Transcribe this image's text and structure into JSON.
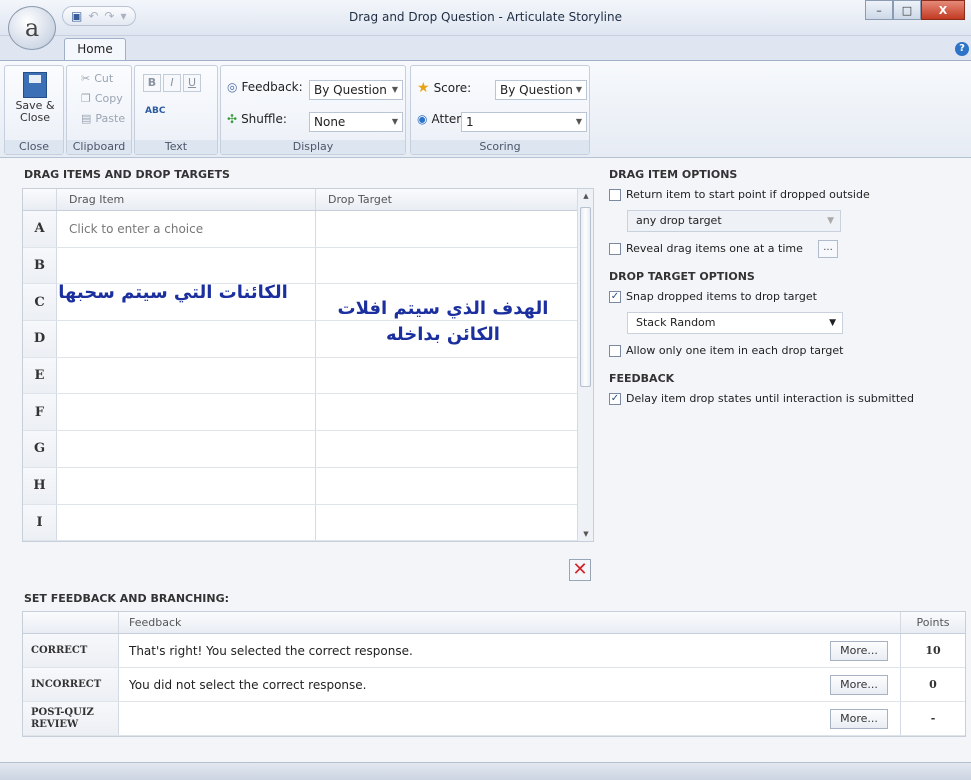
{
  "window": {
    "title": "Drag and Drop Question - Articulate Storyline",
    "logo_letter": "a",
    "minimize": "–",
    "maximize": "□",
    "close": "X"
  },
  "ribbon": {
    "tab": "Home",
    "close_group": {
      "save_label": "Save & Close",
      "group_label": "Close"
    },
    "clipboard": {
      "cut": "Cut",
      "copy": "Copy",
      "paste": "Paste",
      "group_label": "Clipboard"
    },
    "text": {
      "bold": "B",
      "italic": "I",
      "underline": "U",
      "group_label": "Text",
      "spell_icon": "ABC"
    },
    "display": {
      "feedback_label": "Feedback:",
      "feedback_value": "By Question",
      "shuffle_label": "Shuffle:",
      "shuffle_value": "None",
      "group_label": "Display"
    },
    "scoring": {
      "score_label": "Score:",
      "score_value": "By Question",
      "attempts_label": "Attempts:",
      "attempts_value": "1",
      "group_label": "Scoring"
    },
    "help": "?"
  },
  "drag_drop": {
    "title": "DRAG ITEMS AND DROP TARGETS",
    "col_drag": "Drag Item",
    "col_drop": "Drop Target",
    "rows": [
      {
        "letter": "A",
        "drag": "Click to enter a choice"
      },
      {
        "letter": "B",
        "drag": ""
      },
      {
        "letter": "C",
        "drag": ""
      },
      {
        "letter": "D",
        "drag": ""
      },
      {
        "letter": "E",
        "drag": ""
      },
      {
        "letter": "F",
        "drag": ""
      },
      {
        "letter": "G",
        "drag": ""
      },
      {
        "letter": "H",
        "drag": ""
      },
      {
        "letter": "I",
        "drag": ""
      }
    ],
    "overlay_drag": "الكائنات التي سيتم سحبها",
    "overlay_drop": "الهدف الذي سيتم افلات الكائن بداخله",
    "delete_icon": "✕"
  },
  "options": {
    "drag_title": "DRAG ITEM OPTIONS",
    "return_item": "Return item to start point if dropped outside",
    "return_item_checked": false,
    "return_dropdown": "any drop target",
    "reveal_items": "Reveal drag items one at a time",
    "reveal_items_checked": false,
    "reveal_button": "...",
    "drop_title": "DROP TARGET OPTIONS",
    "snap": "Snap dropped items to drop target",
    "snap_checked": true,
    "stack_dropdown": "Stack Random",
    "allow_one": "Allow only one item in each drop target",
    "allow_one_checked": false,
    "feedback_title": "FEEDBACK",
    "delay": "Delay item drop states until interaction is submitted",
    "delay_checked": true
  },
  "feedback": {
    "title": "SET FEEDBACK AND BRANCHING:",
    "col_feedback": "Feedback",
    "col_points": "Points",
    "rows": [
      {
        "label": "CORRECT",
        "text": "That's right!  You selected the correct response.",
        "more": "More...",
        "points": "10"
      },
      {
        "label": "INCORRECT",
        "text": "You did not select the correct response.",
        "more": "More...",
        "points": "0"
      },
      {
        "label": "POST-QUIZ REVIEW",
        "text": "",
        "more": "More...",
        "points": "-"
      }
    ]
  }
}
